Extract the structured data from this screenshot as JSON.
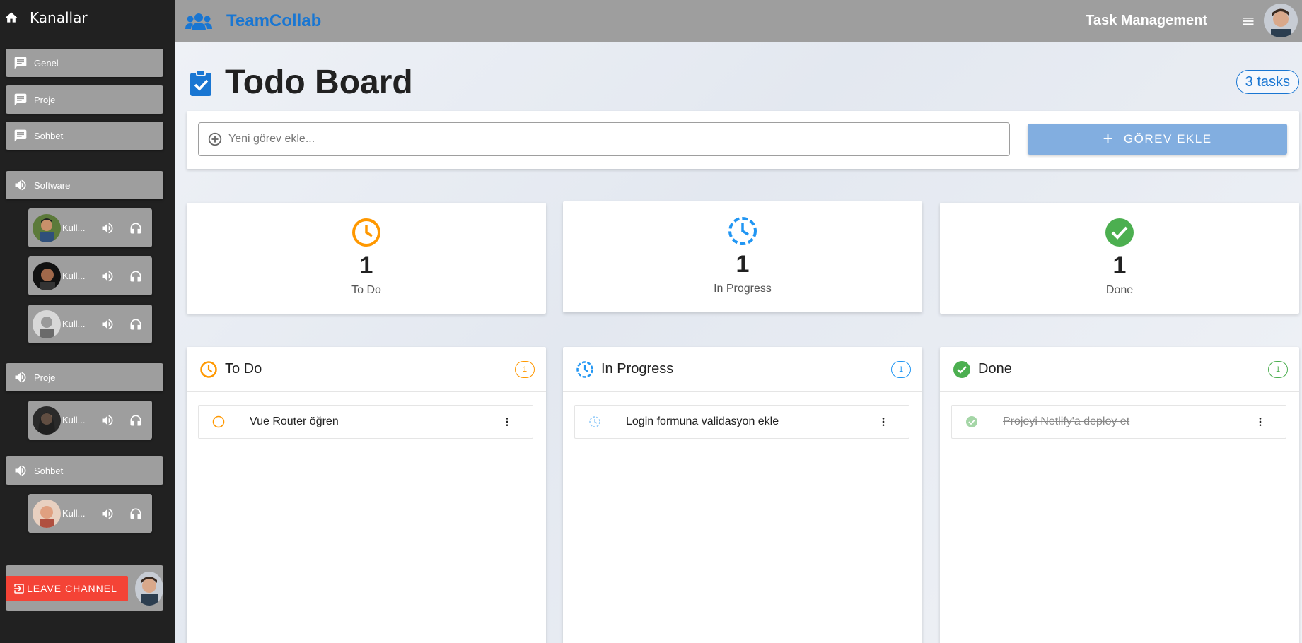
{
  "sidebar": {
    "title": "Kanallar",
    "text_channels": [
      {
        "label": "Genel"
      },
      {
        "label": "Proje"
      },
      {
        "label": "Sohbet"
      }
    ],
    "voice_channels": [
      {
        "label": "Software",
        "users": [
          "Kull...",
          "Kull...",
          "Kull..."
        ]
      },
      {
        "label": "Proje",
        "users": [
          "Kull..."
        ]
      },
      {
        "label": "Sohbet",
        "users": [
          "Kull..."
        ]
      }
    ],
    "leave_label": "LEAVE CHANNEL"
  },
  "topbar": {
    "brand": "TeamCollab",
    "right_title": "Task Management",
    "brand_color": "#1976d2"
  },
  "page": {
    "title": "Todo Board",
    "task_count": "3 tasks"
  },
  "add_task": {
    "placeholder": "Yeni görev ekle...",
    "button_label": "GÖREV EKLE"
  },
  "stats": [
    {
      "value": "1",
      "label": "To Do",
      "color": "#ff9800",
      "icon": "clock-icon"
    },
    {
      "value": "1",
      "label": "In Progress",
      "color": "#2196f3",
      "icon": "progress-clock-icon"
    },
    {
      "value": "1",
      "label": "Done",
      "color": "#4caf50",
      "icon": "check-circle-icon"
    }
  ],
  "columns": [
    {
      "title": "To Do",
      "count": "1",
      "color": "#ff9800",
      "tasks": [
        "Vue Router öğren"
      ]
    },
    {
      "title": "In Progress",
      "count": "1",
      "color": "#2196f3",
      "tasks": [
        "Login formuna validasyon ekle"
      ]
    },
    {
      "title": "Done",
      "count": "1",
      "color": "#4caf50",
      "tasks": [
        "Projeyi Netlify'a deploy et"
      ]
    }
  ]
}
